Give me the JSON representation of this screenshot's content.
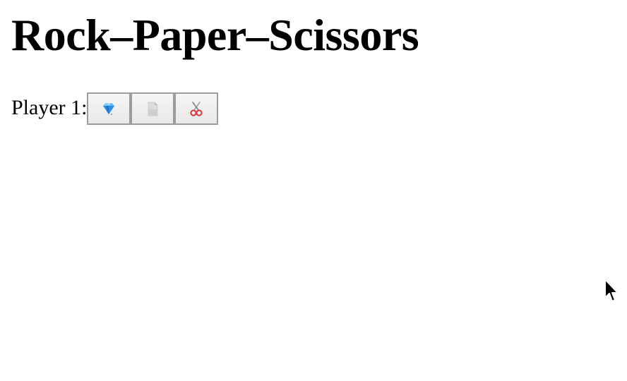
{
  "page": {
    "title": "Rock–Paper–Scissors"
  },
  "player1": {
    "label": "Player 1:",
    "choices": [
      {
        "name": "rock",
        "icon": "gem-icon"
      },
      {
        "name": "paper",
        "icon": "page-icon"
      },
      {
        "name": "scissors",
        "icon": "scissors-icon"
      }
    ]
  },
  "colors": {
    "button_border": "#9c9c9c",
    "button_bg": "#efefef",
    "gem_blue": "#3aa0f0",
    "scissors_red": "#d8363b"
  }
}
